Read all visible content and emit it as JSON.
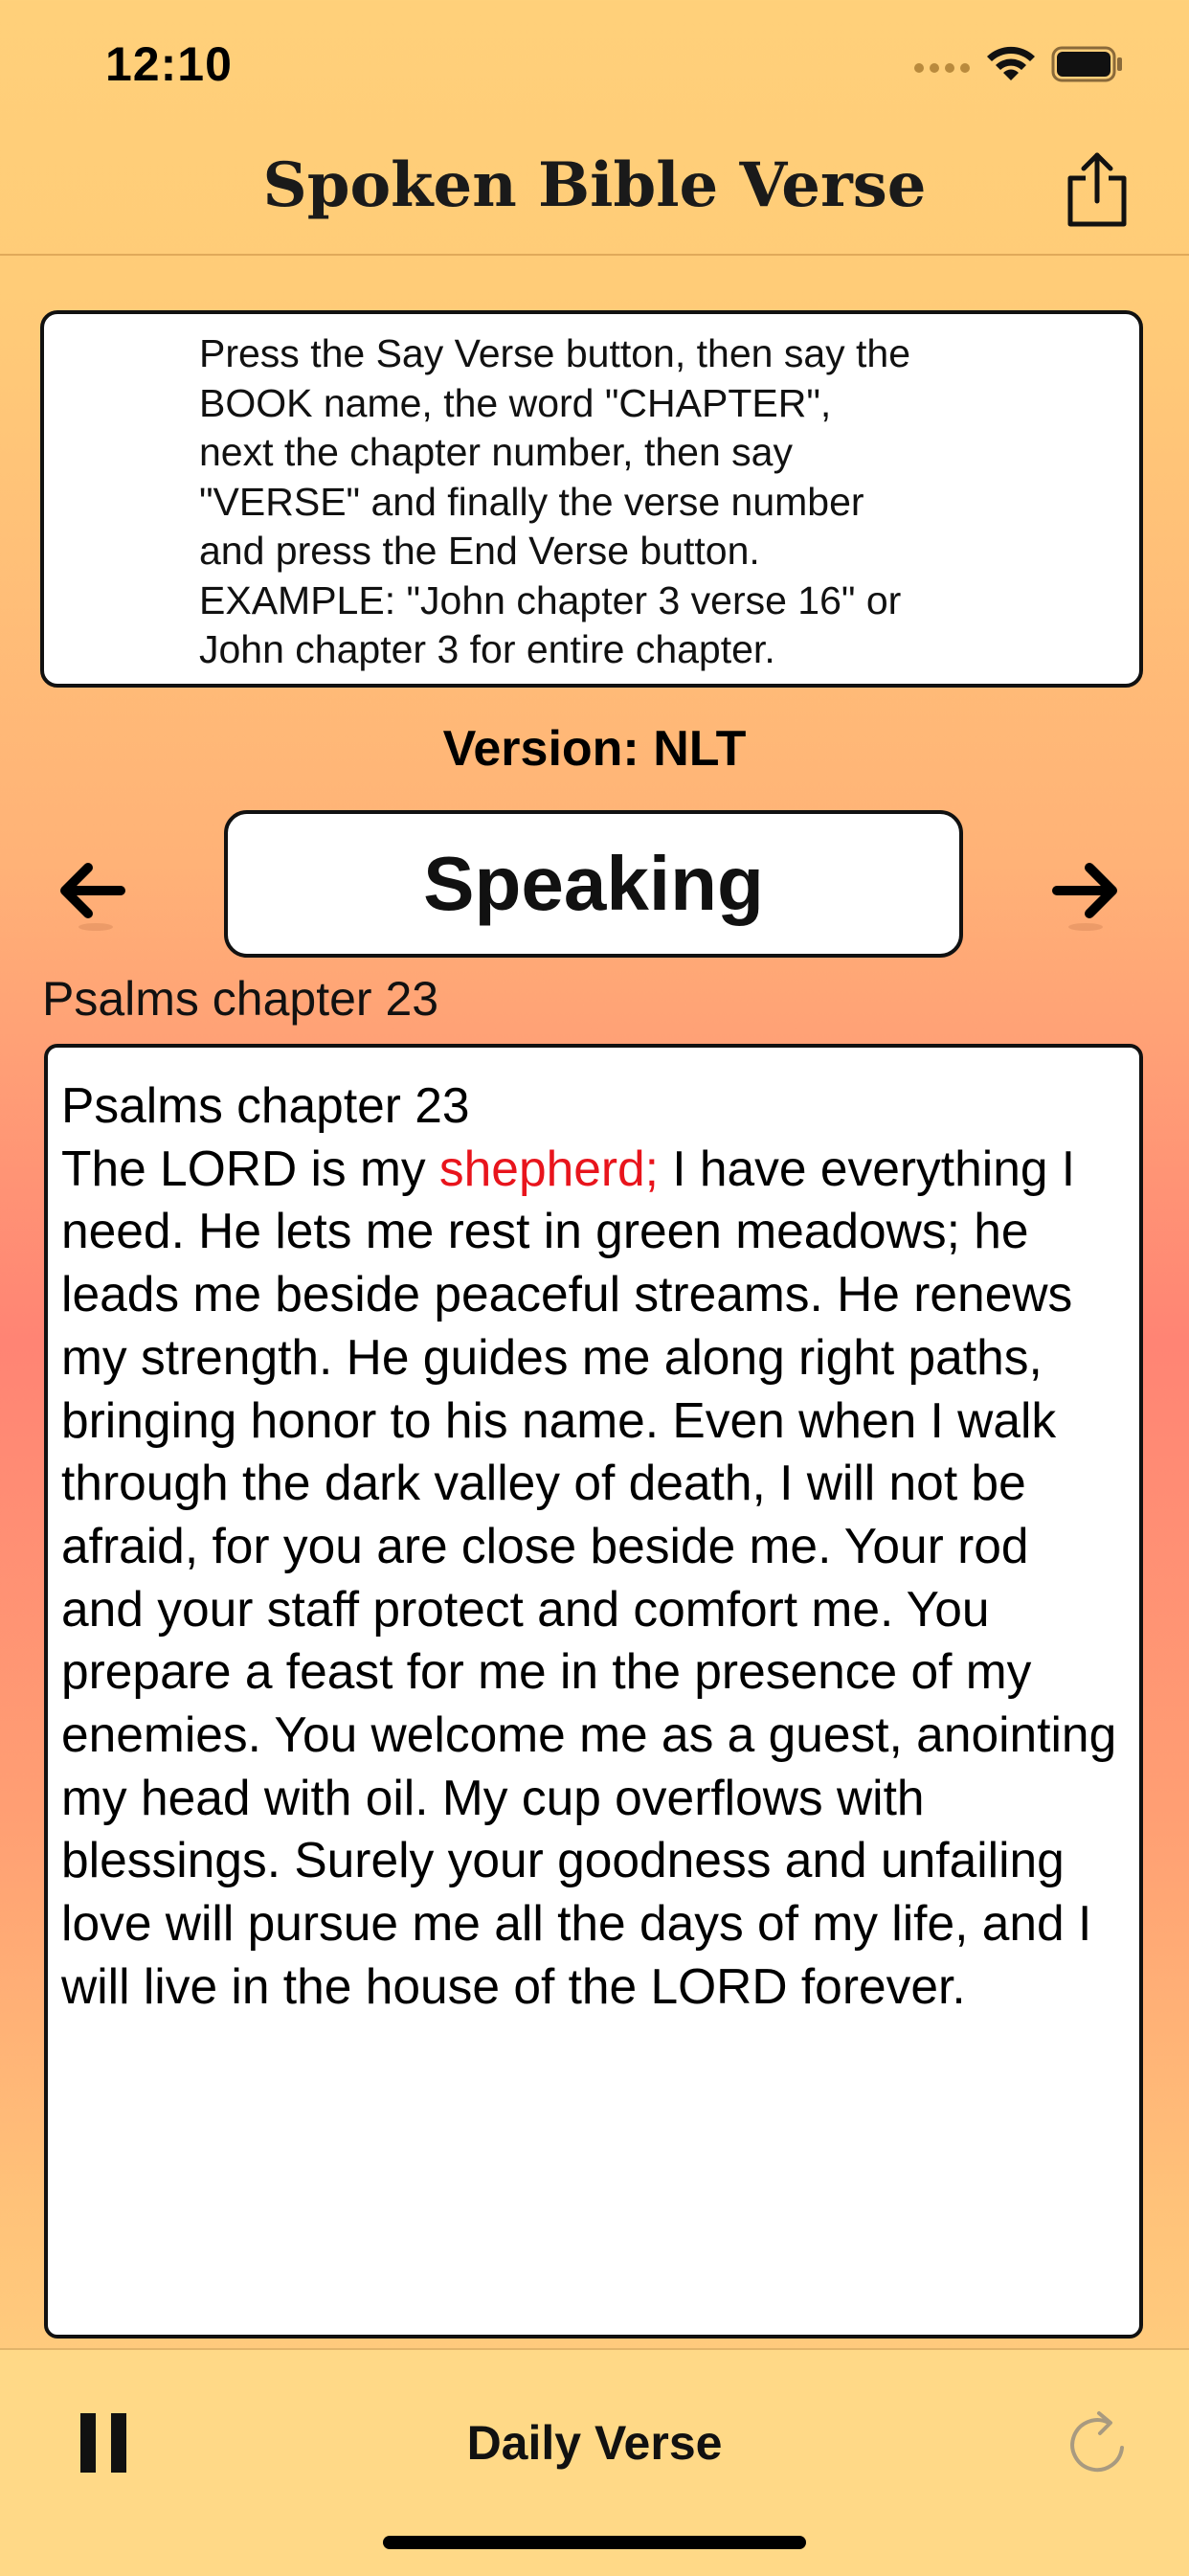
{
  "status_bar": {
    "time": "12:10"
  },
  "nav": {
    "title": "Spoken Bible Verse"
  },
  "instructions": {
    "text": "Press the Say Verse button, then say the\nBOOK name, the word \"CHAPTER\",\nnext the chapter number, then say\n\"VERSE\" and finally the verse number\nand press the End Verse button.\nEXAMPLE: \"John chapter 3 verse 16\" or\nJohn chapter 3 for entire chapter."
  },
  "version": {
    "label": "Version: NLT"
  },
  "speak_button": {
    "label": "Speaking"
  },
  "reference": {
    "label": "Psalms chapter 23"
  },
  "verse": {
    "heading": "Psalms chapter 23",
    "before_highlight": "The LORD is my ",
    "highlight": "shepherd;",
    "after_highlight": " I have everything I need. He lets me rest in green meadows; he leads me beside peaceful streams. He renews my strength. He guides me along right paths, bringing honor to his name. Even when I walk through the dark valley of death, I will not be afraid, for you are close beside me. Your rod and your staff protect and comfort me. You prepare a feast for me in the presence of my enemies. You welcome me as a guest, anointing my head with oil. My cup overflows with blessings. Surely your goodness and unfailing love will pursue me all the days of my life, and I will live in the house of the LORD forever."
  },
  "toolbar": {
    "daily_verse_label": "Daily Verse"
  },
  "colors": {
    "highlight": "#e8141c",
    "refresh_icon": "#a89a80"
  },
  "icons": [
    "wifi-icon",
    "battery-icon",
    "share-icon",
    "arrow-left-icon",
    "arrow-right-icon",
    "pause-icon",
    "refresh-icon"
  ]
}
